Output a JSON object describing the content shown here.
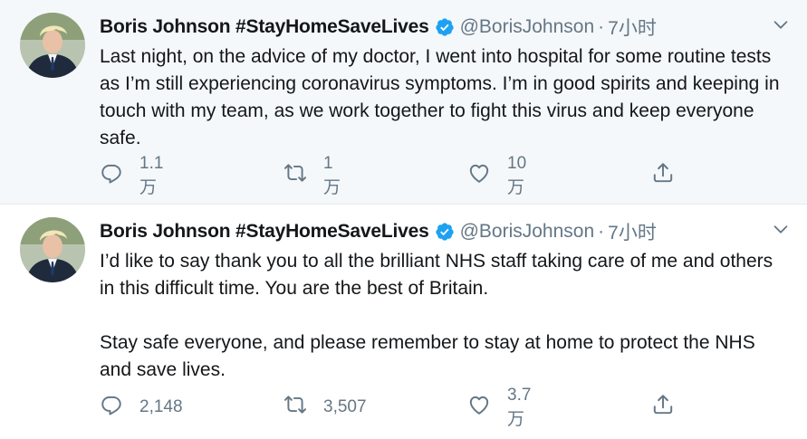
{
  "tweets": [
    {
      "author_name": "Boris Johnson #StayHomeSaveLives",
      "handle": "@BorisJohnson",
      "separator": "·",
      "time": "7小时",
      "paragraphs": [
        "Last night, on the advice of my doctor, I went into hospital for some routine tests as I’m still experiencing coronavirus symptoms. I’m in good spirits and keeping in touch with my team, as we work together to fight this virus and keep everyone safe."
      ],
      "replies": "1.1万",
      "retweets": "1万",
      "likes": "10万"
    },
    {
      "author_name": "Boris Johnson #StayHomeSaveLives",
      "handle": "@BorisJohnson",
      "separator": "·",
      "time": "7小时",
      "paragraphs": [
        "I’d like to say thank you to all the brilliant NHS staff taking care of me and others in this difficult time. You are the best of Britain.",
        "Stay safe everyone, and please remember to stay at home to protect the NHS and save lives."
      ],
      "replies": "2,148",
      "retweets": "3,507",
      "likes": "3.7万"
    }
  ],
  "icons": {
    "verified": "verified-badge-icon",
    "caret": "chevron-down-icon",
    "reply": "reply-icon",
    "retweet": "retweet-icon",
    "like": "heart-icon",
    "share": "share-icon"
  },
  "colors": {
    "verified": "#1da1f2",
    "muted": "#657786",
    "text": "#14171a",
    "thread_bg": "#f5f8fa"
  }
}
